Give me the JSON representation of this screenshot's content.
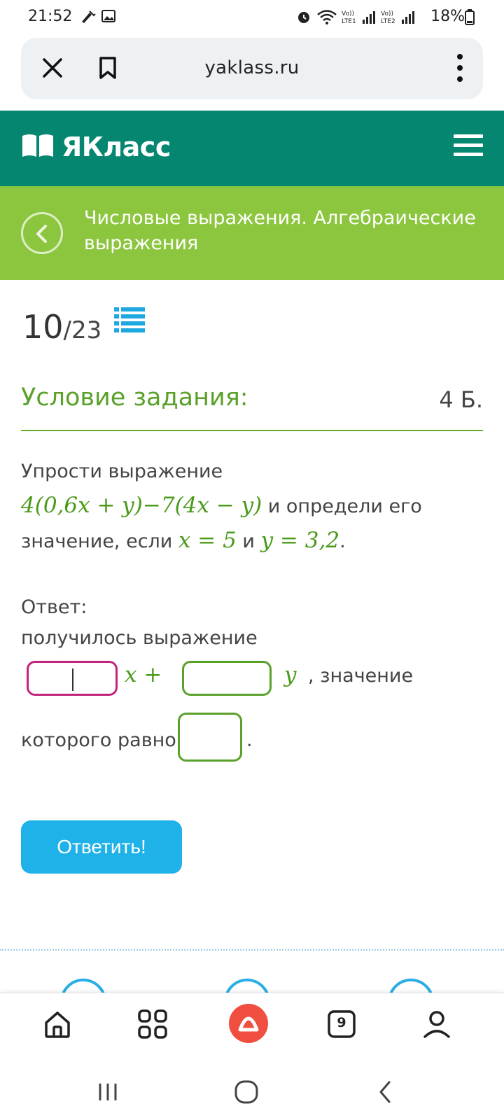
{
  "status_bar": {
    "time": "21:52",
    "battery": "18%",
    "icons": [
      "tools-icon",
      "gallery-icon",
      "alarm-icon",
      "wifi-icon",
      "signal-lte1-icon",
      "signal-lte2-icon",
      "battery-icon"
    ]
  },
  "browser": {
    "url": "yaklass.ru",
    "icons": [
      "close-icon",
      "bookmark-icon",
      "more-vert-icon"
    ]
  },
  "header": {
    "logo_text": "ЯКласс",
    "logo_icon": "book-icon",
    "menu_icon": "hamburger-icon",
    "bg_color": "#058670"
  },
  "breadcrumb": {
    "title": "Числовые выражения. Алгебраические выражения",
    "back_icon": "chevron-left-icon",
    "bg_color": "#8cc63f"
  },
  "progress": {
    "current": "10",
    "total": "/23",
    "list_icon": "list-icon"
  },
  "task": {
    "heading": "Условие задания:",
    "points": "4 Б.",
    "prompt": "Упрости выражение",
    "expression": "4(0,6x + y)−7(4x − y)",
    "middle_text": " и определи его значение, если ",
    "x_cond": "x = 5",
    "and_word": " и ",
    "y_cond": "y = 3,2",
    "end_dot": "."
  },
  "answer": {
    "label": "Ответ:",
    "line1": "получилось выражение",
    "x_term": "x +",
    "y_term": "y",
    "after_y": ", значение",
    "line3": "которого равно",
    "end_dot": ".",
    "input1_value": "",
    "input2_value": "",
    "input3_value": ""
  },
  "submit_label": "Ответить!",
  "bottom_nav": {
    "tabs_count": "9",
    "icons": [
      "home-icon",
      "apps-icon",
      "alice-icon",
      "tabs-icon",
      "profile-icon"
    ]
  },
  "system_nav": {
    "icons": [
      "recents-icon",
      "home-circle-icon",
      "back-icon"
    ]
  },
  "colors": {
    "accent_green": "#5aa12a",
    "error_magenta": "#c2237b",
    "button_blue": "#1fb2e8"
  }
}
